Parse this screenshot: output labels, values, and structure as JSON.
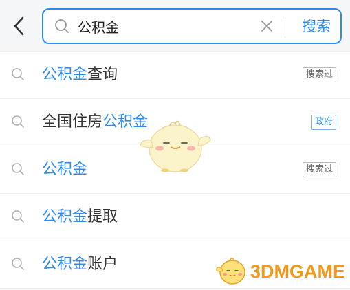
{
  "header": {
    "back_icon": "chevron-left-icon",
    "search": {
      "value": "公积金",
      "placeholder": "",
      "search_icon": "search-icon",
      "clear_icon": "close-icon",
      "submit_label": "搜索"
    }
  },
  "suggestions": [
    {
      "highlight": "公积金",
      "rest_before": "",
      "rest_after": "查询",
      "tag": "搜索过",
      "tag_type": "history"
    },
    {
      "highlight": "公积金",
      "rest_before": "全国住房",
      "rest_after": "",
      "tag": "政府",
      "tag_type": "gov"
    },
    {
      "highlight": "公积金",
      "rest_before": "",
      "rest_after": "",
      "tag": "搜索过",
      "tag_type": "history"
    },
    {
      "highlight": "公积金",
      "rest_before": "",
      "rest_after": "提取",
      "tag": "",
      "tag_type": ""
    },
    {
      "highlight": "公积金",
      "rest_before": "",
      "rest_after": "账户",
      "tag": "",
      "tag_type": ""
    }
  ],
  "watermark": {
    "text": "3DMGAME"
  },
  "colors": {
    "accent": "#2d8cf0",
    "watermark": "#f29a18",
    "text": "#333333",
    "icon_gray": "#b0b0b0"
  }
}
